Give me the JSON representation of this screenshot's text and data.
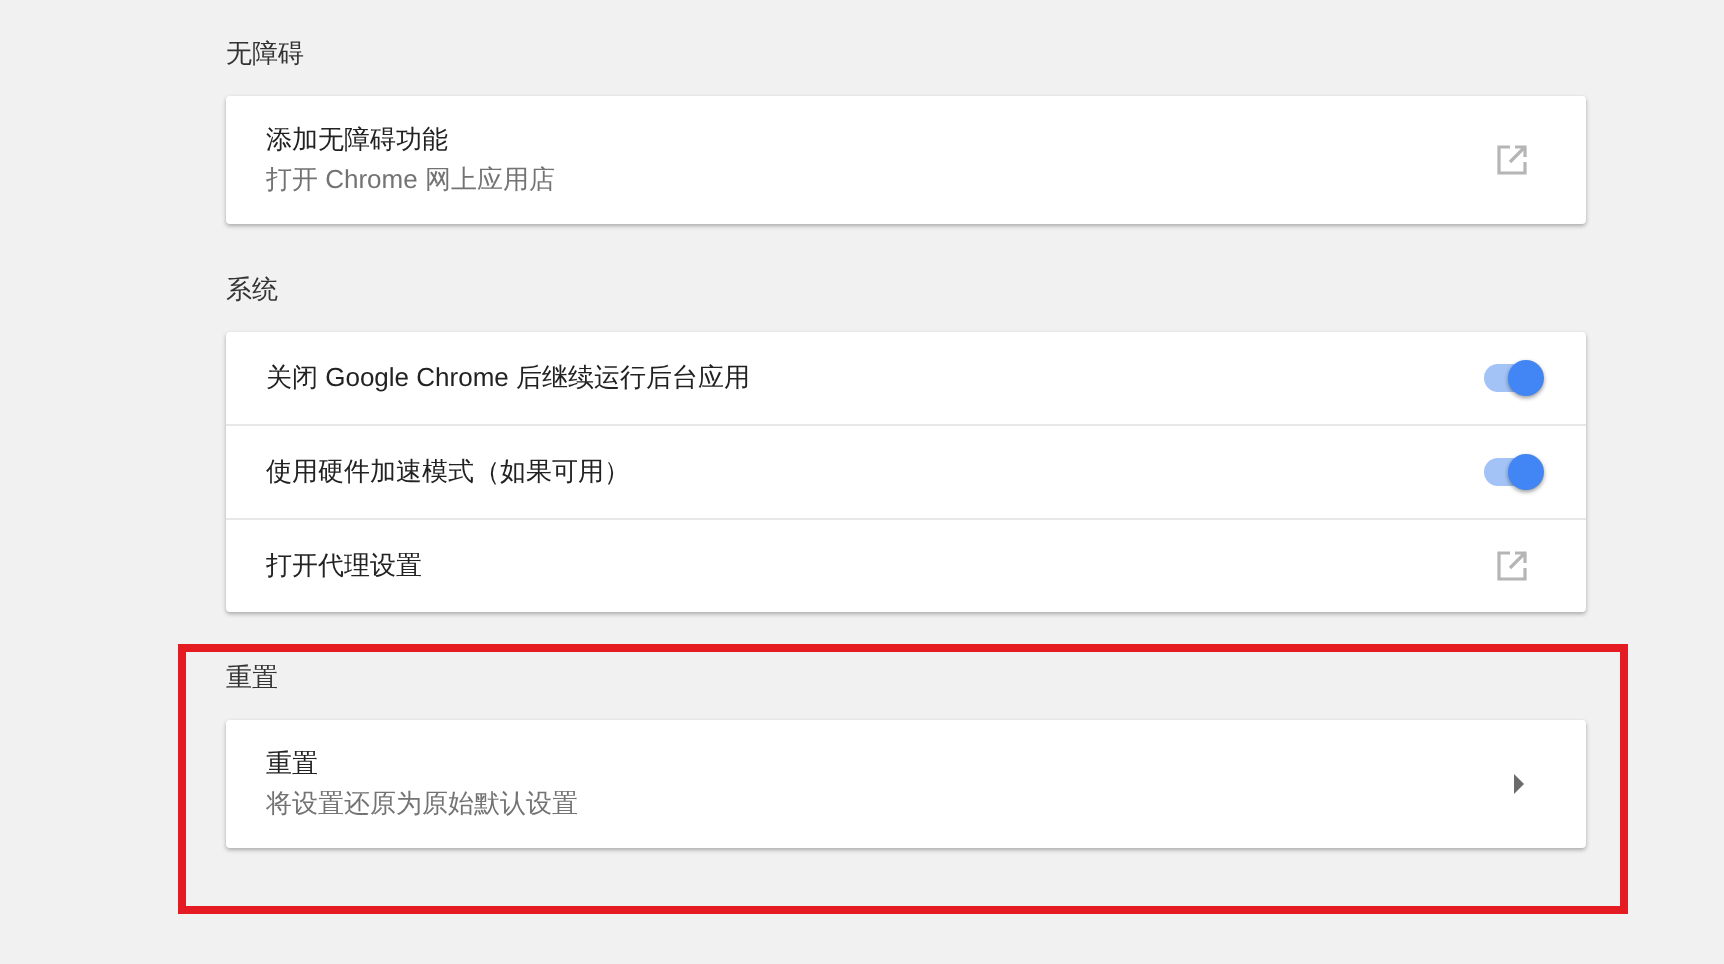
{
  "sections": [
    {
      "title": "无障碍",
      "highlighted": false,
      "rows": [
        {
          "kind": "link",
          "label": "添加无障碍功能",
          "sublabel": "打开 Chrome 网上应用店"
        }
      ]
    },
    {
      "title": "系统",
      "highlighted": false,
      "rows": [
        {
          "kind": "toggle",
          "label": "关闭 Google Chrome 后继续运行后台应用",
          "on": true
        },
        {
          "kind": "toggle",
          "label": "使用硬件加速模式（如果可用）",
          "on": true
        },
        {
          "kind": "link",
          "label": "打开代理设置"
        }
      ]
    },
    {
      "title": "重置",
      "highlighted": true,
      "rows": [
        {
          "kind": "arrow",
          "label": "重置",
          "sublabel": "将设置还原为原始默认设置"
        }
      ]
    }
  ]
}
